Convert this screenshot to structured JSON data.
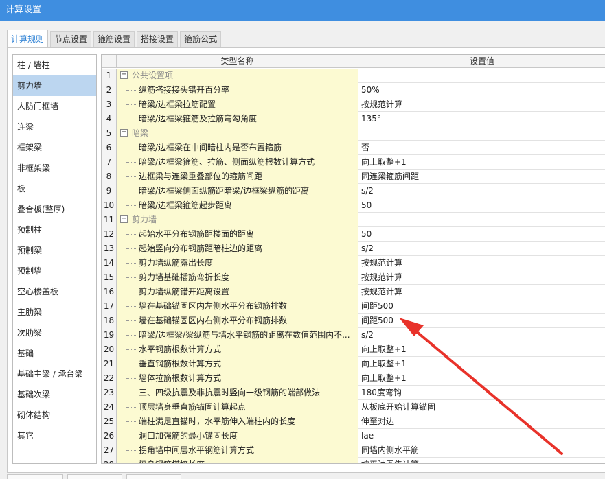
{
  "window": {
    "title": "计算设置"
  },
  "tabs": [
    {
      "label": "计算规则",
      "active": true
    },
    {
      "label": "节点设置",
      "active": false
    },
    {
      "label": "箍筋设置",
      "active": false
    },
    {
      "label": "搭接设置",
      "active": false
    },
    {
      "label": "箍筋公式",
      "active": false
    }
  ],
  "sidebar": {
    "items": [
      "柱 / 墙柱",
      "剪力墙",
      "人防门框墙",
      "连梁",
      "框架梁",
      "非框架梁",
      "板",
      "叠合板(整厚)",
      "预制柱",
      "预制梁",
      "预制墙",
      "空心楼盖板",
      "主肋梁",
      "次肋梁",
      "基础",
      "基础主梁 / 承台梁",
      "基础次梁",
      "砌体结构",
      "其它"
    ],
    "selected_index": 1
  },
  "grid": {
    "col_name": "类型名称",
    "col_value": "设置值",
    "rows": [
      {
        "num": "1",
        "name": "公共设置项",
        "value": "",
        "group": true
      },
      {
        "num": "2",
        "name": "纵筋搭接接头错开百分率",
        "value": "50%"
      },
      {
        "num": "3",
        "name": "暗梁/边框梁拉筋配置",
        "value": "按规范计算"
      },
      {
        "num": "4",
        "name": "暗梁/边框梁箍筋及拉筋弯勾角度",
        "value": "135°"
      },
      {
        "num": "5",
        "name": "暗梁",
        "value": "",
        "group": true
      },
      {
        "num": "6",
        "name": "暗梁/边框梁在中间暗柱内是否布置箍筋",
        "value": "否"
      },
      {
        "num": "7",
        "name": "暗梁/边框梁箍筋、拉筋、侧面纵筋根数计算方式",
        "value": "向上取整+1"
      },
      {
        "num": "8",
        "name": "边框梁与连梁重叠部位的箍筋间距",
        "value": "同连梁箍筋间距"
      },
      {
        "num": "9",
        "name": "暗梁/边框梁侧面纵筋距暗梁/边框梁纵筋的距离",
        "value": "s/2"
      },
      {
        "num": "10",
        "name": "暗梁/边框梁箍筋起步距离",
        "value": "50"
      },
      {
        "num": "11",
        "name": "剪力墙",
        "value": "",
        "group": true
      },
      {
        "num": "12",
        "name": "起始水平分布钢筋距楼面的距离",
        "value": "50"
      },
      {
        "num": "13",
        "name": "起始竖向分布钢筋距暗柱边的距离",
        "value": "s/2"
      },
      {
        "num": "14",
        "name": "剪力墙纵筋露出长度",
        "value": "按规范计算"
      },
      {
        "num": "15",
        "name": "剪力墙基础插筋弯折长度",
        "value": "按规范计算"
      },
      {
        "num": "16",
        "name": "剪力墙纵筋错开距离设置",
        "value": "按规范计算"
      },
      {
        "num": "17",
        "name": "墙在基础锚固区内左侧水平分布钢筋排数",
        "value": "间距500"
      },
      {
        "num": "18",
        "name": "墙在基础锚固区内右侧水平分布钢筋排数",
        "value": "间距500"
      },
      {
        "num": "19",
        "name": "暗梁/边框梁/梁纵筋与墙水平钢筋的距离在数值范围内不...",
        "value": "s/2"
      },
      {
        "num": "20",
        "name": "水平钢筋根数计算方式",
        "value": "向上取整+1"
      },
      {
        "num": "21",
        "name": "垂直钢筋根数计算方式",
        "value": "向上取整+1"
      },
      {
        "num": "22",
        "name": "墙体拉筋根数计算方式",
        "value": "向上取整+1"
      },
      {
        "num": "23",
        "name": "三、四级抗震及非抗震时竖向一级钢筋的端部做法",
        "value": "180度弯钩"
      },
      {
        "num": "24",
        "name": "顶层墙身垂直筋锚固计算起点",
        "value": "从板底开始计算锚固"
      },
      {
        "num": "25",
        "name": "端柱满足直锚时，水平筋伸入端柱内的长度",
        "value": "伸至对边"
      },
      {
        "num": "26",
        "name": "洞口加强筋的最小锚固长度",
        "value": "lae"
      },
      {
        "num": "27",
        "name": "拐角墙中间层水平钢筋计算方式",
        "value": "同墙内侧水平筋"
      },
      {
        "num": "28",
        "name": "墙身钢筋搭接长度",
        "value": "按平法图集计算"
      }
    ]
  },
  "colors": {
    "title_bar": "#3f8ee0",
    "name_cell": "#fcfad2",
    "selected": "#bcd6f0",
    "annotation_arrow": "#e8322a"
  }
}
